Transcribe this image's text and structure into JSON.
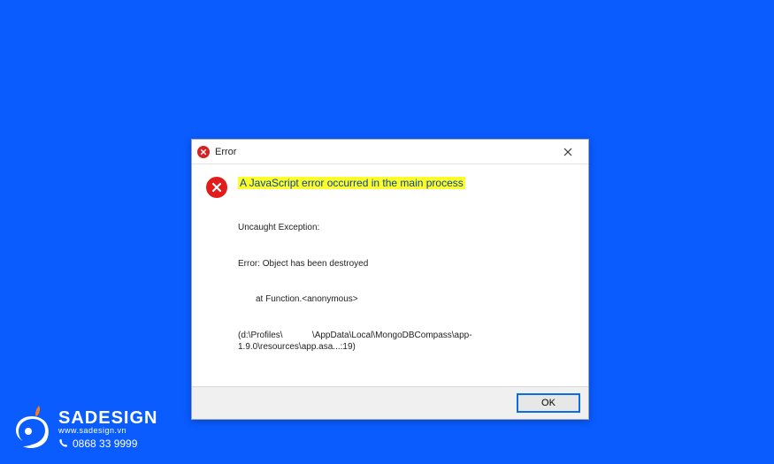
{
  "dialog": {
    "title": "Error",
    "headline": "A JavaScript error occurred in the main process",
    "details": {
      "l1": "Uncaught Exception:",
      "l2": "Error: Object has been destroyed",
      "l3": "at Function.<anonymous>",
      "l4": "(d:\\Profiles\\            \\AppData\\Local\\MongoDBCompass\\app-1.9.0\\resources\\app.asa...:19)"
    },
    "ok_label": "OK"
  },
  "brand": {
    "name": "SADESIGN",
    "url": "www.sadesign.vn",
    "phone": "0868 33 9999"
  }
}
